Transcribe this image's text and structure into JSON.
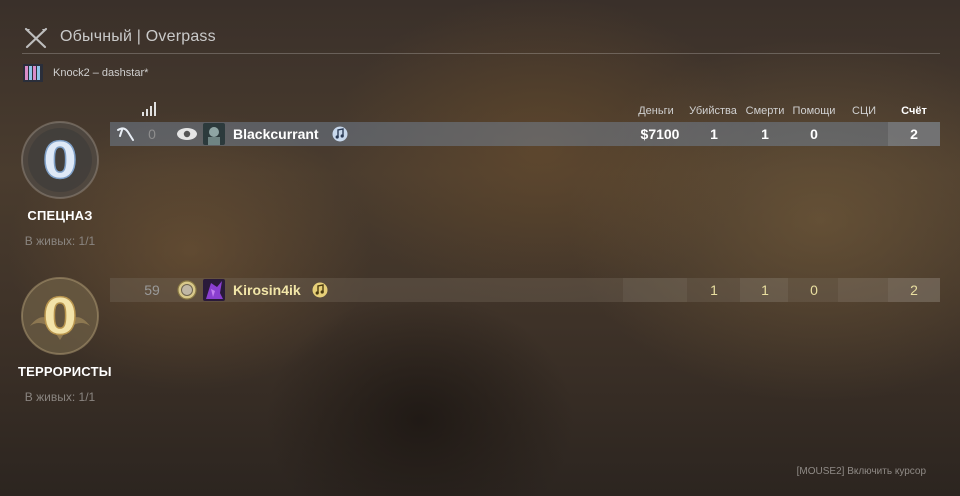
{
  "header": {
    "mode_text": "Обычный | Overpass",
    "server_name": "Knock2 – dashstar*"
  },
  "columns": {
    "money": "Деньги",
    "kills": "Убийства",
    "deaths": "Смерти",
    "assists": "Помощи",
    "mvp": "СЦИ",
    "score": "Счёт"
  },
  "teams": {
    "ct": {
      "score": "0",
      "name": "СПЕЦНАЗ",
      "alive": "В живых: 1/1",
      "color": "#b8cde8"
    },
    "t": {
      "score": "0",
      "name": "ТЕРРОРИСТЫ",
      "alive": "В живых: 1/1",
      "color": "#e8d9a0"
    }
  },
  "players": {
    "ct": {
      "ping": "0",
      "name": "Blackcurrant",
      "money": "$7100",
      "kills": "1",
      "deaths": "1",
      "assists": "0",
      "mvp": "",
      "score": "2"
    },
    "t": {
      "ping": "59",
      "name": "Kirosin4ik",
      "money": "",
      "kills": "1",
      "deaths": "1",
      "assists": "0",
      "mvp": "",
      "score": "2"
    }
  },
  "footer": {
    "hint": "[MOUSE2] Включить курсор"
  }
}
